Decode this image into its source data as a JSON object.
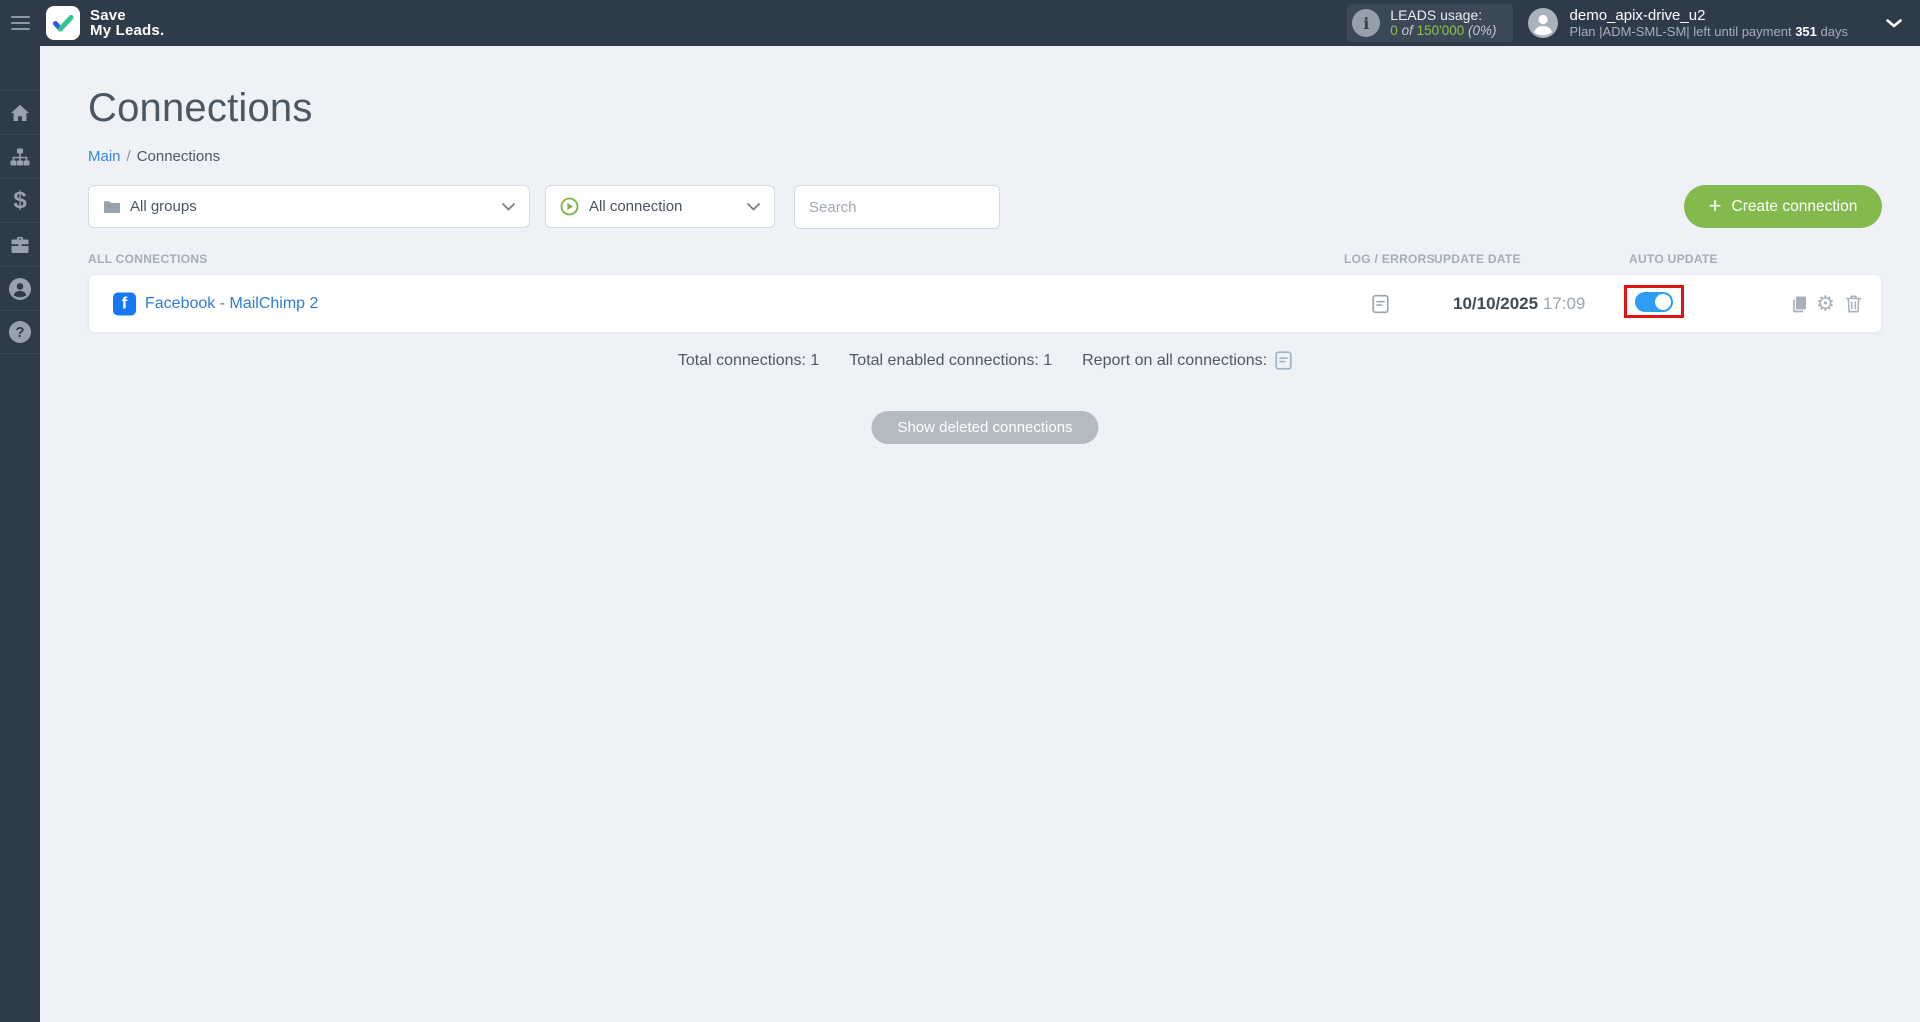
{
  "header": {
    "logo": {
      "line1": "Save",
      "line2": "My Leads."
    },
    "leads_usage": {
      "label": "LEADS usage:",
      "used": "0",
      "of_word": "of",
      "limit": "150'000",
      "percent": "(0%)"
    },
    "user": {
      "name": "demo_apix-drive_u2",
      "plan_line_prefix": "Plan |ADM-SML-SM| left until payment",
      "days": "351",
      "days_suffix": "days"
    }
  },
  "sidebar": {
    "items": [
      {
        "icon": "home"
      },
      {
        "icon": "connections-sitemap"
      },
      {
        "icon": "billing-dollar"
      },
      {
        "icon": "services-briefcase"
      },
      {
        "icon": "profile-person"
      },
      {
        "icon": "help-question"
      }
    ]
  },
  "page": {
    "title": "Connections",
    "breadcrumb": {
      "link": "Main",
      "separator": "/",
      "current": "Connections"
    },
    "filters": {
      "groups_label": "All groups",
      "connection_label": "All connection",
      "search_placeholder": "Search",
      "create_button": "Create connection"
    },
    "table": {
      "headers": {
        "all_connections": "ALL CONNECTIONS",
        "log_errors": "LOG / ERRORS",
        "update_date": "UPDATE DATE",
        "auto_update": "AUTO UPDATE"
      },
      "rows": [
        {
          "name": "Facebook - MailChimp 2",
          "update_date": "10/10/2025",
          "update_time": "17:09",
          "auto_update_on": true
        }
      ]
    },
    "summary": {
      "total_label": "Total connections:",
      "total_value": "1",
      "enabled_label": "Total enabled connections:",
      "enabled_value": "1",
      "report_label": "Report on all connections:"
    },
    "show_deleted_button": "Show deleted connections"
  },
  "icons": {
    "gear": "⚙",
    "plus": "+",
    "info": "i",
    "facebook": "f",
    "dollar": "$",
    "question": "?"
  },
  "colors": {
    "header_bg": "#2e3b49",
    "main_bg": "#eef1f6",
    "accent_green": "#8bc34a",
    "button_green": "#84b94e",
    "link_blue": "#3d85d8",
    "facebook_blue": "#1877f2",
    "toggle_on_blue": "#2d9cf4",
    "annotation_red": "#e31212",
    "gray_icon": "#a9b2ba"
  }
}
